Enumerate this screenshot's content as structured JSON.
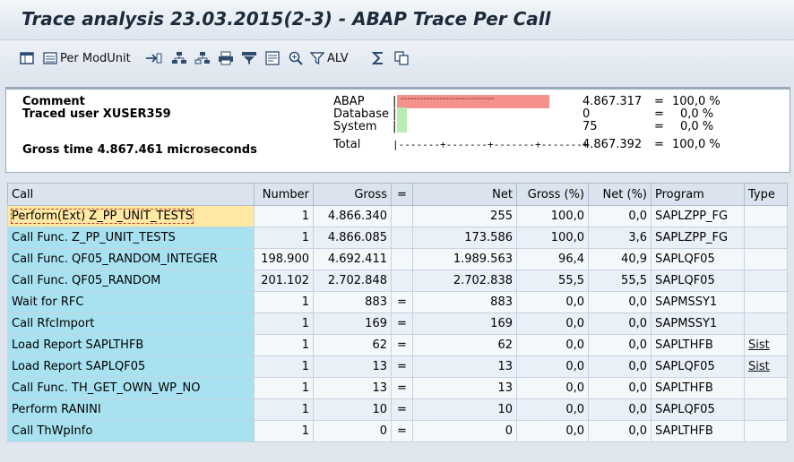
{
  "window": {
    "title": "Trace analysis 23.03.2015(2-3) - ABAP Trace Per Call"
  },
  "toolbar": {
    "per_mod_unit_label": "Per ModUnit",
    "alv_label": "ALV"
  },
  "summary": {
    "comment_label": "Comment",
    "traced_user": "Traced user XUSER359",
    "gross_time": "Gross time 4.867.461 microseconds",
    "rows": [
      {
        "label": "ABAP",
        "bar": "|",
        "value": "4.867.317",
        "eq": "=",
        "pct": "100,0 %",
        "share": 1.0
      },
      {
        "label": "Database",
        "bar": "|",
        "value": "0",
        "eq": "=",
        "pct": "0,0 %",
        "share": 0.0
      },
      {
        "label": "System",
        "bar": "|",
        "value": "75",
        "eq": "=",
        "pct": "0,0 %",
        "share": 0.0
      },
      {
        "label": "Total",
        "bar": "|-------+-------+-------+-------+",
        "value": "4.867.392",
        "eq": "=",
        "pct": "100,0 %"
      }
    ],
    "abap_bar_text": "-----------------------------",
    "colors": {
      "abap": "#f5918b",
      "database": "#b8ecb2",
      "system": "#b8ecb2"
    }
  },
  "table": {
    "headers": [
      "Call",
      "Number",
      "Gross",
      "=",
      "Net",
      "Gross (%)",
      "Net (%)",
      "Program",
      "Type"
    ],
    "rows": [
      {
        "call": "Perform(Ext) Z_PP_UNIT_TESTS",
        "number": "1",
        "gross": "4.866.340",
        "eq": "",
        "net": "255",
        "gross_pct": "100,0",
        "net_pct": "0,0",
        "program": "SAPLZPP_FG",
        "type": ""
      },
      {
        "call": "Call Func. Z_PP_UNIT_TESTS",
        "number": "1",
        "gross": "4.866.085",
        "eq": "",
        "net": "173.586",
        "gross_pct": "100,0",
        "net_pct": "3,6",
        "program": "SAPLZPP_FG",
        "type": ""
      },
      {
        "call": "Call Func. QF05_RANDOM_INTEGER",
        "number": "198.900",
        "gross": "4.692.411",
        "eq": "",
        "net": "1.989.563",
        "gross_pct": "96,4",
        "net_pct": "40,9",
        "program": "SAPLQF05",
        "type": ""
      },
      {
        "call": "Call Func. QF05_RANDOM",
        "number": "201.102",
        "gross": "2.702.848",
        "eq": "",
        "net": "2.702.838",
        "gross_pct": "55,5",
        "net_pct": "55,5",
        "program": "SAPLQF05",
        "type": ""
      },
      {
        "call": "Wait for RFC",
        "number": "1",
        "gross": "883",
        "eq": "=",
        "net": "883",
        "gross_pct": "0,0",
        "net_pct": "0,0",
        "program": "SAPMSSY1",
        "type": ""
      },
      {
        "call": "Call RfcImport",
        "number": "1",
        "gross": "169",
        "eq": "=",
        "net": "169",
        "gross_pct": "0,0",
        "net_pct": "0,0",
        "program": "SAPMSSY1",
        "type": ""
      },
      {
        "call": "Load Report SAPLTHFB",
        "number": "1",
        "gross": "62",
        "eq": "=",
        "net": "62",
        "gross_pct": "0,0",
        "net_pct": "0,0",
        "program": "SAPLTHFB",
        "type": "Sist"
      },
      {
        "call": "Load Report SAPLQF05",
        "number": "1",
        "gross": "13",
        "eq": "=",
        "net": "13",
        "gross_pct": "0,0",
        "net_pct": "0,0",
        "program": "SAPLQF05",
        "type": "Sist"
      },
      {
        "call": "Call Func. TH_GET_OWN_WP_NO",
        "number": "1",
        "gross": "13",
        "eq": "=",
        "net": "13",
        "gross_pct": "0,0",
        "net_pct": "0,0",
        "program": "SAPLTHFB",
        "type": ""
      },
      {
        "call": "Perform RANINI",
        "number": "1",
        "gross": "10",
        "eq": "=",
        "net": "10",
        "gross_pct": "0,0",
        "net_pct": "0,0",
        "program": "SAPLQF05",
        "type": ""
      },
      {
        "call": "Call ThWpInfo",
        "number": "1",
        "gross": "0",
        "eq": "=",
        "net": "0",
        "gross_pct": "0,0",
        "net_pct": "0,0",
        "program": "SAPLTHFB",
        "type": ""
      }
    ],
    "colors": {
      "call_column": "#a8e2f0",
      "selected_call": "#ffe9a3"
    }
  },
  "icons": [
    "hierarchy-icon",
    "per-modunit-icon",
    "navigate-icon",
    "tree-expand-icon",
    "tree-collapse-icon",
    "print-icon",
    "filter-icon",
    "layout-icon",
    "zoom-icon",
    "alv-filter-icon",
    "sum-icon",
    "copy-icon"
  ]
}
